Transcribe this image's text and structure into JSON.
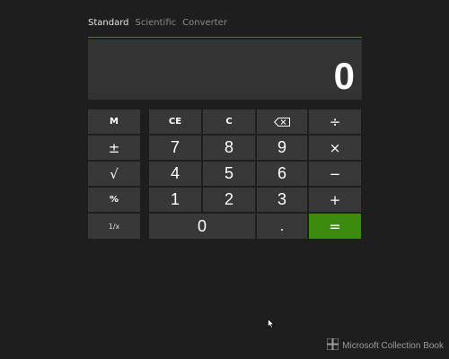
{
  "tabs": [
    "Standard",
    "Scientific",
    "Converter"
  ],
  "display": {
    "value": "0"
  },
  "memory_buttons": {
    "memory": "M",
    "plus_minus": "±",
    "sqrt": "√",
    "percent": "%",
    "reciprocal": "1/x"
  },
  "keys": {
    "ce": "CE",
    "c": "C",
    "divide": "÷",
    "multiply": "×",
    "minus": "−",
    "plus": "+",
    "equals": "=",
    "decimal": ".",
    "d0": "0",
    "d1": "1",
    "d2": "2",
    "d3": "3",
    "d4": "4",
    "d5": "5",
    "d6": "6",
    "d7": "7",
    "d8": "8",
    "d9": "9"
  },
  "icons": {
    "backspace": "backspace-icon",
    "windows_logo": "windows-logo-icon",
    "cursor": "mouse-pointer-icon"
  },
  "colors": {
    "accent": "#3c8a0e",
    "background": "#1e1e1e",
    "button": "#383838",
    "display": "#333333"
  },
  "watermark": "Microsoft Collection Book"
}
